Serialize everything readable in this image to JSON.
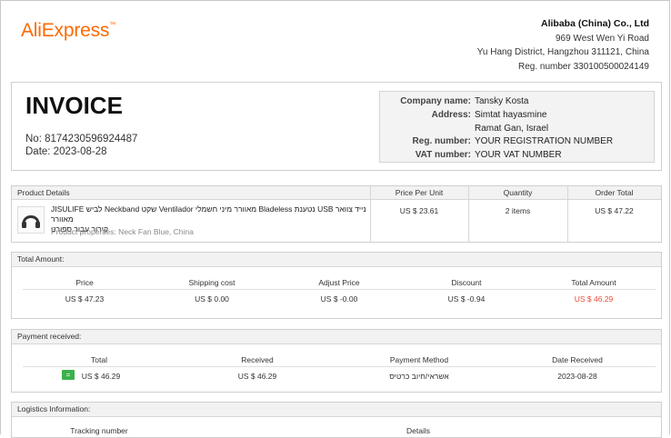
{
  "brand": {
    "logo_text": "AliExpress",
    "accent": "#ff6a00"
  },
  "company": {
    "name": "Alibaba (China) Co., Ltd",
    "address1": "969 West Wen Yi Road",
    "address2": "Yu Hang District, Hangzhou 311121, China",
    "reg": "Reg. number 330100500024149"
  },
  "invoice": {
    "title": "INVOICE",
    "number": "No: 8174230596924487",
    "date": "Date: 2023-08-28"
  },
  "buyer": {
    "company_label": "Company name:",
    "company_value": "Tansky Kosta",
    "address_label": "Address:",
    "address_line1": "Simtat hayasmine",
    "address_line2": "Ramat Gan, Israel",
    "reg_label": "Reg. number:",
    "reg_value": "YOUR REGISTRATION NUMBER",
    "vat_label": "VAT number:",
    "vat_value": "YOUR VAT NUMBER"
  },
  "product_table": {
    "headers": {
      "details": "Product Details",
      "price": "Price Per Unit",
      "qty": "Quantity",
      "total": "Order Total"
    },
    "item": {
      "name_line1": "JISULIFE לביש Neckband שקט Ventilador מאוורר מיני חשמלי Bladeless נטענת USB נייד צוואר מאוורר",
      "name_line2": "קירור עבור ספורט",
      "properties": "Product properties: Neck Fan Blue, China",
      "price": "US $ 23.61",
      "qty": "2 items",
      "total": "US $ 47.22",
      "icon": "headphones-icon"
    }
  },
  "total_amount": {
    "title": "Total Amount:",
    "headers": {
      "price": "Price",
      "shipping": "Shipping cost",
      "adjust": "Adjust Price",
      "discount": "Discount",
      "total": "Total Amount"
    },
    "values": {
      "price": "US $ 47.23",
      "shipping": "US $ 0.00",
      "adjust": "US $ -0.00",
      "discount": "US $ -0.94",
      "total": "US $ 46.29"
    },
    "total_color": "#e74c3c"
  },
  "payment": {
    "title": "Payment received:",
    "headers": {
      "total": "Total",
      "received": "Received",
      "method": "Payment Method",
      "date": "Date Received"
    },
    "values": {
      "badge": "=",
      "total": "US $ 46.29",
      "received": "US $ 46.29",
      "method": "אשראי/חיוב כרטיס",
      "date": "2023-08-28"
    }
  },
  "logistics": {
    "title": "Logistics Information:",
    "headers": {
      "tracking": "Tracking number",
      "details": "Details"
    }
  }
}
